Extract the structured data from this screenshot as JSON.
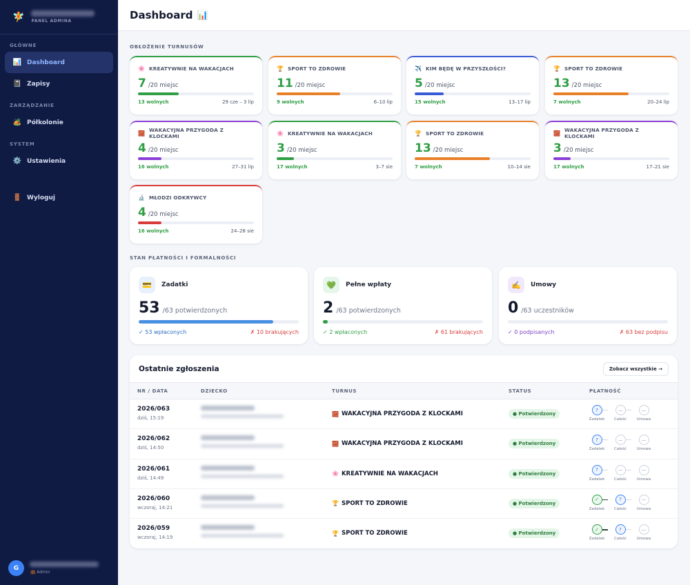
{
  "sidebar": {
    "logo_icon": "🧚",
    "panel_label": "PANEL ADMINA",
    "sections": [
      {
        "title": "GŁÓWNE",
        "items": [
          {
            "label": "Dashboard",
            "icon": "📊",
            "active": true
          },
          {
            "label": "Zapisy",
            "icon": "📓"
          }
        ]
      },
      {
        "title": "ZARZĄDZANIE",
        "items": [
          {
            "label": "Półkolonie",
            "icon": "🏕️"
          }
        ]
      },
      {
        "title": "SYSTEM",
        "items": [
          {
            "label": "Ustawienia",
            "icon": "⚙️"
          }
        ]
      }
    ],
    "logout": {
      "label": "Wyloguj",
      "icon": "🚪"
    },
    "user": {
      "initial": "G",
      "role": "Admin",
      "role_icon": "💼"
    }
  },
  "header": {
    "title": "Dashboard",
    "icon": "📊"
  },
  "occupancy": {
    "title": "OBŁOŻENIE TURNUSÓW",
    "capacity_label": "/20 miejsc",
    "free_suffix": "wolnych",
    "cards": [
      {
        "name": "KREATYWNIE NA WAKACJACH",
        "icon": "🌸",
        "count": "7",
        "free": "13",
        "dates": "29 cze – 3 lip",
        "color": "#2f9e44"
      },
      {
        "name": "SPORT TO ZDROWIE",
        "icon": "🏆",
        "count": "11",
        "free": "9",
        "dates": "6–10 lip",
        "color": "#e8802a"
      },
      {
        "name": "KIM BĘDĘ W PRZYSZŁOŚCI?",
        "icon": "✈️",
        "count": "5",
        "free": "15",
        "dates": "13–17 lip",
        "color": "#3a5bd6"
      },
      {
        "name": "SPORT TO ZDROWIE",
        "icon": "🏆",
        "count": "13",
        "free": "7",
        "dates": "20–24 lip",
        "color": "#e8802a"
      },
      {
        "name": "WAKACYJNA PRZYGODA Z KLOCKAMI",
        "icon": "🧱",
        "count": "4",
        "free": "16",
        "dates": "27–31 lip",
        "color": "#8b3fd6"
      },
      {
        "name": "KREATYWNIE NA WAKACJACH",
        "icon": "🌸",
        "count": "3",
        "free": "17",
        "dates": "3–7 sie",
        "color": "#2f9e44"
      },
      {
        "name": "SPORT TO ZDROWIE",
        "icon": "🏆",
        "count": "13",
        "free": "7",
        "dates": "10–14 sie",
        "color": "#e8802a"
      },
      {
        "name": "WAKACYJNA PRZYGODA Z KLOCKAMI",
        "icon": "🧱",
        "count": "3",
        "free": "17",
        "dates": "17–21 sie",
        "color": "#8b3fd6"
      },
      {
        "name": "MŁODZI ODKRYWCY",
        "icon": "🔬",
        "count": "4",
        "free": "16",
        "dates": "24–28 sie",
        "color": "#d93b3b"
      }
    ]
  },
  "payments": {
    "title": "STAN PŁATNOŚCI I FORMALNOŚCI",
    "cards": [
      {
        "title": "Zadatki",
        "icon": "💳",
        "icon_bg": "#e7f0fb",
        "count": "53",
        "total": "/63 potwierdzonych",
        "progress": 0.84,
        "bar_color": "#4a90e2",
        "ok": "✓ 53 wpłaconych",
        "ok_color": "#2d6cc0",
        "bad": "✗ 10 brakujących"
      },
      {
        "title": "Pełne wpłaty",
        "icon": "💚",
        "icon_bg": "#e6f6ea",
        "count": "2",
        "total": "/63 potwierdzonych",
        "progress": 0.032,
        "bar_color": "#2f9e44",
        "ok": "✓ 2 wpłaconych",
        "ok_color": "#2f9e44",
        "bad": "✗ 61 brakujących"
      },
      {
        "title": "Umowy",
        "icon": "✍️",
        "icon_bg": "#f2e8fb",
        "count": "0",
        "total": "/63 uczestników",
        "progress": 0,
        "bar_color": "#8b3fd6",
        "ok": "✓ 0 podpisanych",
        "ok_color": "#7b3fc6",
        "bad": "✗ 63 bez podpisu"
      }
    ]
  },
  "recent": {
    "title": "Ostatnie zgłoszenia",
    "view_all": "Zobacz wszystkie →",
    "columns": [
      "NR / DATA",
      "DZIECKO",
      "TURNUS",
      "STATUS",
      "PŁATNOŚĆ"
    ],
    "step_labels": [
      "Zadatek",
      "Całość",
      "Umowa"
    ],
    "rows": [
      {
        "nr": "2026/063",
        "date": "dziś, 15:19",
        "turnus": "WAKACYJNA PRZYGODA Z KLOCKAMI",
        "icon": "🧱",
        "status": "● Potwierdzony",
        "steps": [
          "?",
          "—",
          "—"
        ]
      },
      {
        "nr": "2026/062",
        "date": "dziś, 14:50",
        "turnus": "WAKACYJNA PRZYGODA Z KLOCKAMI",
        "icon": "🧱",
        "status": "● Potwierdzony",
        "steps": [
          "?",
          "—",
          "—"
        ]
      },
      {
        "nr": "2026/061",
        "date": "dziś, 14:49",
        "turnus": "KREATYWNIE NA WAKACJACH",
        "icon": "🌸",
        "status": "● Potwierdzony",
        "steps": [
          "?",
          "—",
          "—"
        ]
      },
      {
        "nr": "2026/060",
        "date": "wczoraj, 14:21",
        "turnus": "SPORT TO ZDROWIE",
        "icon": "🏆",
        "status": "● Potwierdzony",
        "steps": [
          "✓",
          "?",
          "—"
        ]
      },
      {
        "nr": "2026/059",
        "date": "wczoraj, 14:19",
        "turnus": "SPORT TO ZDROWIE",
        "icon": "🏆",
        "status": "● Potwierdzony",
        "steps": [
          "✓",
          "?",
          "—"
        ]
      }
    ]
  }
}
